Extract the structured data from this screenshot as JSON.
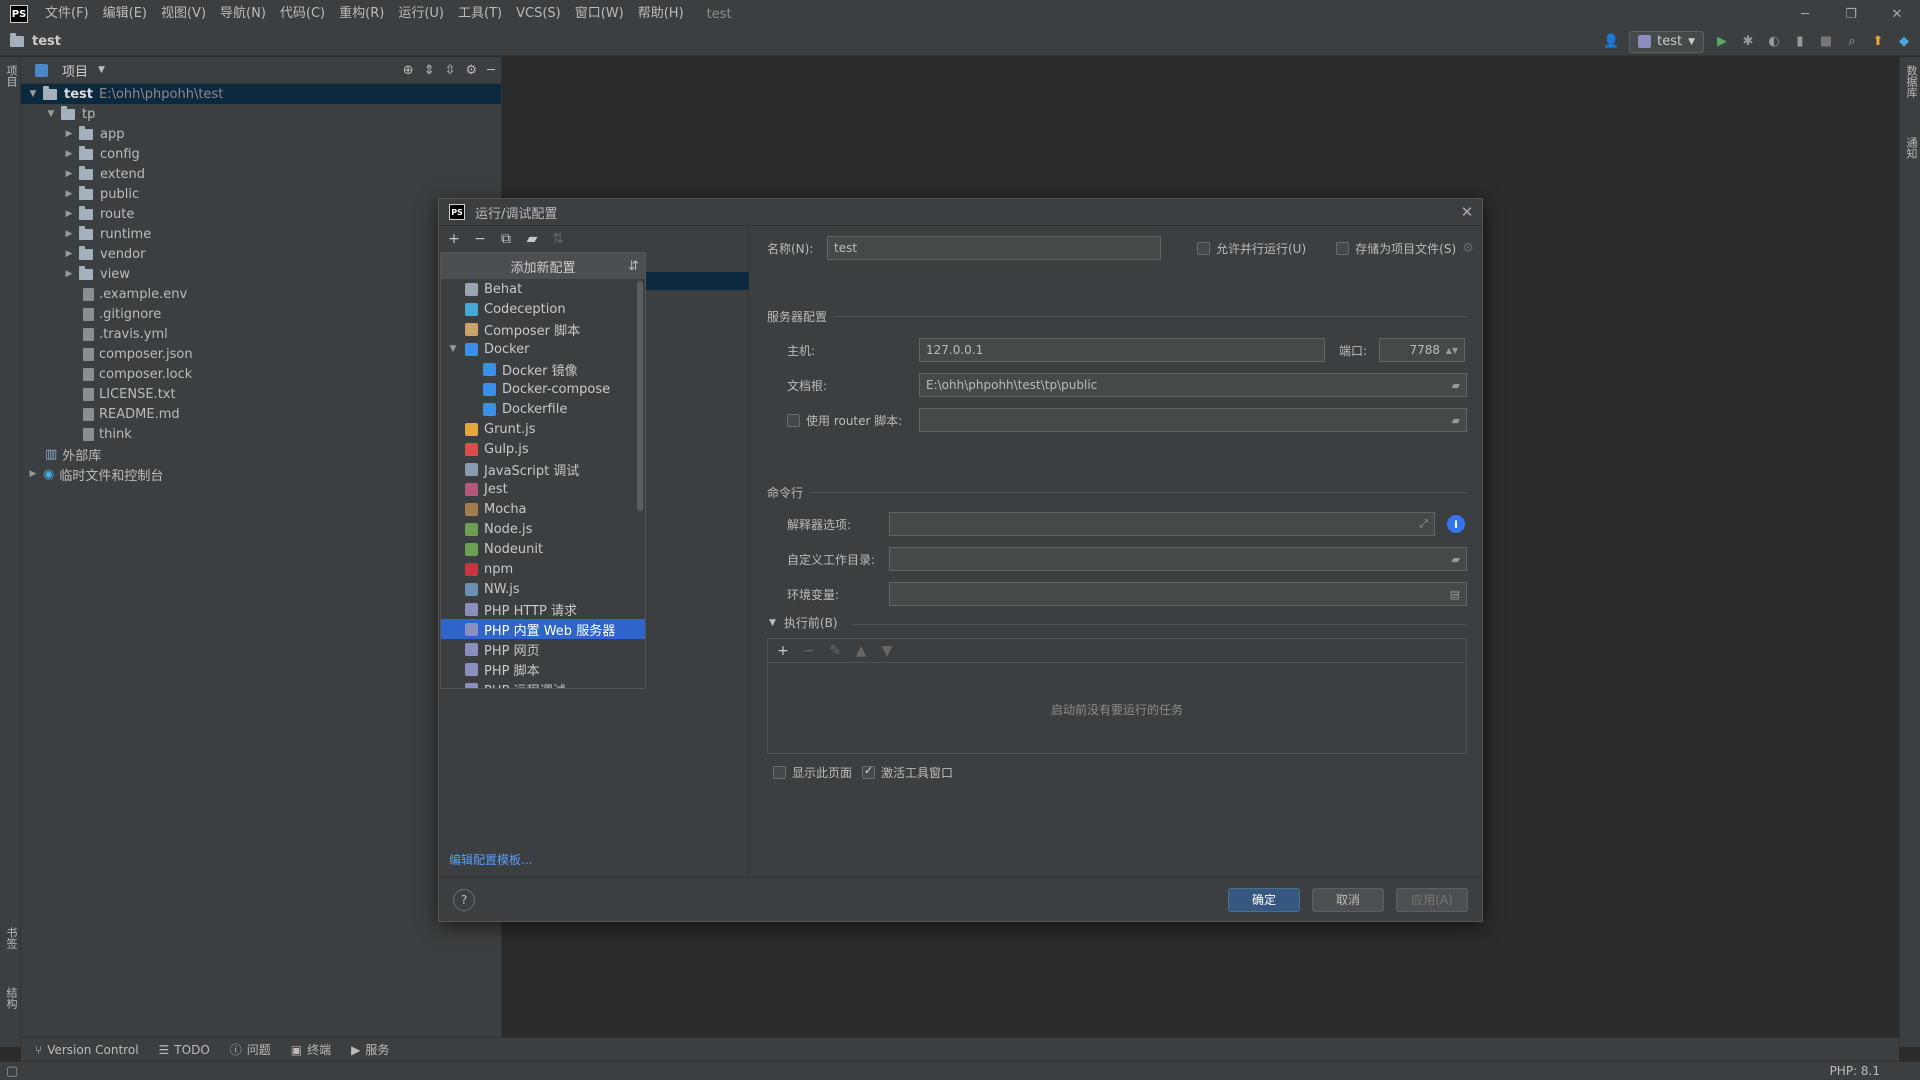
{
  "menubar": {
    "logo": "PS",
    "items": [
      "文件(F)",
      "编辑(E)",
      "视图(V)",
      "导航(N)",
      "代码(C)",
      "重构(R)",
      "运行(U)",
      "工具(T)",
      "VCS(S)",
      "窗口(W)",
      "帮助(H)"
    ],
    "title": "test"
  },
  "navbar": {
    "project": "test",
    "run_config": "test"
  },
  "left_strip": {
    "project_label": "项目",
    "bookmarks_label": "书签",
    "structure_label": "结构"
  },
  "right_strip": {
    "database_label": "数据库",
    "notifications_label": "通知"
  },
  "project_panel": {
    "title": "项目",
    "root": {
      "name": "test",
      "path": "E:\\ohh\\phpohh\\test"
    },
    "tp_folder": "tp",
    "folders": [
      "app",
      "config",
      "extend",
      "public",
      "route",
      "runtime",
      "vendor",
      "view"
    ],
    "files": [
      ".example.env",
      ".gitignore",
      ".travis.yml",
      "composer.json",
      "composer.lock",
      "LICENSE.txt",
      "README.md",
      "think"
    ],
    "external_libs": "外部库",
    "scratches": "临时文件和控制台"
  },
  "bottom_tools": {
    "vcs": "Version Control",
    "todo": "TODO",
    "problems": "问题",
    "terminal": "终端",
    "services": "服务"
  },
  "status_bar": {
    "php": "PHP: 8.1"
  },
  "dialog": {
    "title": "运行/调试配置",
    "popup": {
      "header": "添加新配置",
      "items": [
        {
          "label": "Behat",
          "color": "#9aa5b1",
          "sub": false
        },
        {
          "label": "Codeception",
          "color": "#4aa8d8",
          "sub": false
        },
        {
          "label": "Composer 脚本",
          "color": "#c9a36a",
          "sub": false
        },
        {
          "label": "Docker",
          "color": "#3b8eea",
          "sub": false,
          "expanded": true
        },
        {
          "label": "Docker 镜像",
          "color": "#3b8eea",
          "sub": true
        },
        {
          "label": "Docker-compose",
          "color": "#3b8eea",
          "sub": true
        },
        {
          "label": "Dockerfile",
          "color": "#3b8eea",
          "sub": true
        },
        {
          "label": "Grunt.js",
          "color": "#e2a73a",
          "sub": false
        },
        {
          "label": "Gulp.js",
          "color": "#d94d4d",
          "sub": false
        },
        {
          "label": "JavaScript 调试",
          "color": "#8a9bb0",
          "sub": false
        },
        {
          "label": "Jest",
          "color": "#b5577b",
          "sub": false
        },
        {
          "label": "Mocha",
          "color": "#a57b4f",
          "sub": false
        },
        {
          "label": "Node.js",
          "color": "#6a9f54",
          "sub": false
        },
        {
          "label": "Nodeunit",
          "color": "#6a9f54",
          "sub": false
        },
        {
          "label": "npm",
          "color": "#c9343e",
          "sub": false
        },
        {
          "label": "NW.js",
          "color": "#6b8fb3",
          "sub": false
        },
        {
          "label": "PHP HTTP 请求",
          "color": "#8b8fbf",
          "sub": false
        },
        {
          "label": "PHP 内置 Web 服务器",
          "color": "#8b8fbf",
          "sub": false,
          "selected": true
        },
        {
          "label": "PHP 网页",
          "color": "#8b8fbf",
          "sub": false
        },
        {
          "label": "PHP 脚本",
          "color": "#8b8fbf",
          "sub": false
        },
        {
          "label": "PHP 远程调试",
          "color": "#8b8fbf",
          "sub": false
        }
      ]
    },
    "edit_templates": "编辑配置模板...",
    "name_label": "名称(N):",
    "name_value": "test",
    "allow_parallel": "允许并行运行(U)",
    "store_as_file": "存储为项目文件(S)",
    "server_section": "服务器配置",
    "host_label": "主机:",
    "host_value": "127.0.0.1",
    "port_label": "端口:",
    "port_value": "7788",
    "docroot_label": "文档根:",
    "docroot_value": "E:\\ohh\\phpohh\\test\\tp\\public",
    "router_label": "使用 router 脚本:",
    "cmd_section": "命令行",
    "interp_label": "解释器选项:",
    "workdir_label": "自定义工作目录:",
    "env_label": "环境变量:",
    "before_section": "执行前(B)",
    "before_empty": "启动前没有要运行的任务",
    "show_page": "显示此页面",
    "activate_tool": "激活工具窗口",
    "ok": "确定",
    "cancel": "取消",
    "apply": "应用(A)"
  }
}
